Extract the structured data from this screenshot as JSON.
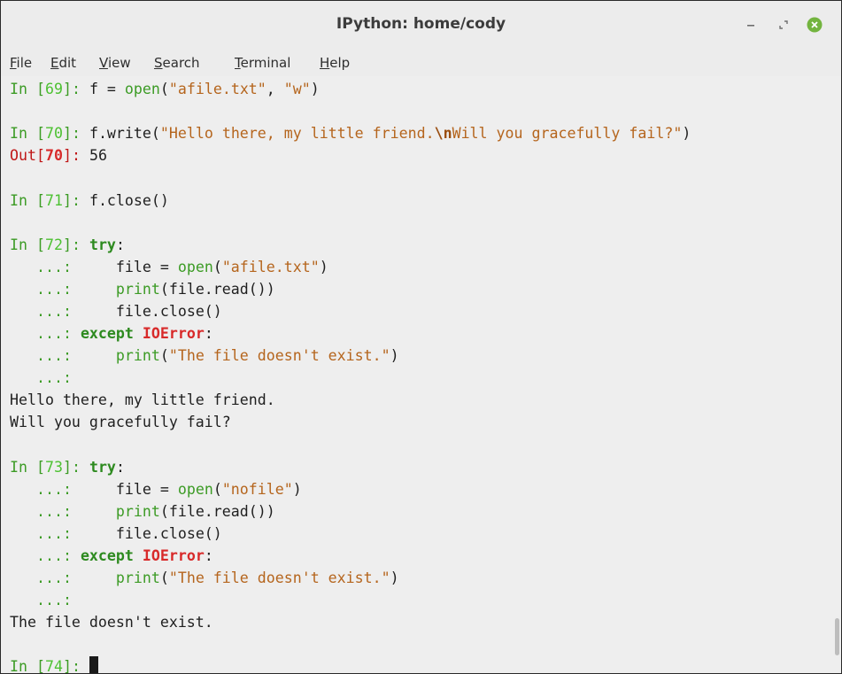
{
  "window": {
    "title": "IPython: home/cody",
    "controls": [
      "minimize-icon",
      "maximize-icon",
      "close-icon"
    ],
    "accent_close": "#73b43f"
  },
  "menu": {
    "file": {
      "mnemonic": "F",
      "rest": "ile"
    },
    "edit": {
      "mnemonic": "E",
      "rest": "dit"
    },
    "view": {
      "mnemonic": "V",
      "rest": "iew"
    },
    "search": {
      "mnemonic": "S",
      "rest": "earch"
    },
    "terminal": {
      "mnemonic": "T",
      "rest": "erminal"
    },
    "help": {
      "mnemonic": "H",
      "rest": "elp"
    }
  },
  "colors": {
    "prompt_green": "#3c9b25",
    "string_orange": "#b5651d",
    "error_red": "#d82a2a",
    "background": "#eeeeee"
  },
  "terminal": {
    "in_word": "In ",
    "out_word": "Out",
    "b1": "[",
    "b2": "]: ",
    "cont": "   ...: ",
    "cont_bare": "   ...:",
    "indent": "    ",
    "s69": {
      "num": "69",
      "pre": "f = ",
      "fn": "open",
      "p1": "(",
      "arg1": "\"afile.txt\"",
      "comma": ", ",
      "arg2": "\"w\"",
      "p2": ")"
    },
    "s70": {
      "num": "70",
      "pre": "f.write(",
      "str1": "\"Hello there, my little friend.",
      "esc": "\\n",
      "str2": "Will you gracefully fail?\"",
      "post": ")",
      "out_num": "70",
      "out_value": "56"
    },
    "s71": {
      "num": "71",
      "code": "f.close()"
    },
    "s72": {
      "num": "72",
      "try_kw": "try",
      "colon": ":",
      "l1_pre": "file = ",
      "open_fn": "open",
      "l1_arg": "\"afile.txt\"",
      "l2_fn": "print",
      "l2_rest": "(file.read())",
      "l3": "file.close()",
      "except_kw": "except",
      "exc_name": "IOError",
      "l5_fn": "print",
      "l5_arg": "\"The file doesn't exist.\"",
      "out1": "Hello there, my little friend.",
      "out2": "Will you gracefully fail?"
    },
    "s73": {
      "num": "73",
      "l1_arg": "\"nofile\"",
      "output": "The file doesn't exist."
    },
    "s74": {
      "num": "74"
    }
  }
}
